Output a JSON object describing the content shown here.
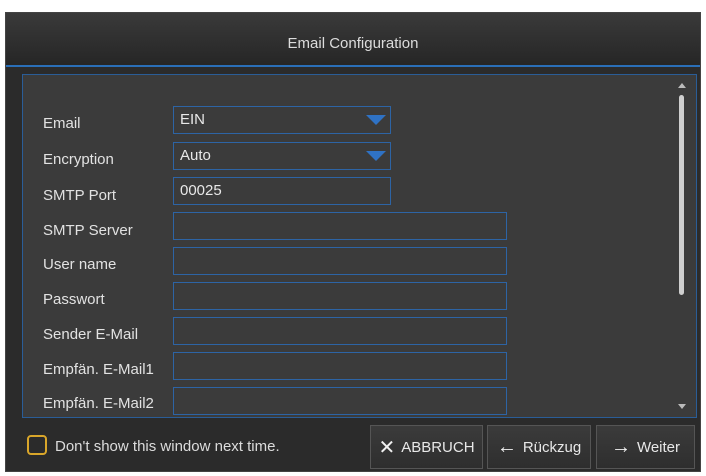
{
  "window": {
    "title": "Email Configuration"
  },
  "form": {
    "rows": [
      {
        "label": "Email",
        "value": "EIN",
        "type": "select"
      },
      {
        "label": "Encryption",
        "value": "Auto",
        "type": "select"
      },
      {
        "label": "SMTP Port",
        "value": "00025",
        "type": "text"
      },
      {
        "label": "SMTP Server",
        "value": "",
        "type": "text"
      },
      {
        "label": "User name",
        "value": "",
        "type": "text"
      },
      {
        "label": "Passwort",
        "value": "",
        "type": "password"
      },
      {
        "label": "Sender E-Mail",
        "value": "",
        "type": "text"
      },
      {
        "label": "Empfän. E-Mail1",
        "value": "",
        "type": "text"
      },
      {
        "label": "Empfän. E-Mail2",
        "value": "",
        "type": "text"
      }
    ]
  },
  "footer": {
    "checkbox_label": "Don't show this window next time.",
    "cancel_label": "ABBRUCH",
    "back_label": "Rückzug",
    "next_label": "Weiter"
  },
  "icons": {
    "cancel": "close-icon",
    "back": "arrow-left-icon",
    "next": "arrow-right-icon",
    "dropdown": "chevron-down-icon"
  },
  "colors": {
    "accent": "#2f72c4",
    "checkbox": "#d9a62a",
    "panel": "#3b3b3b"
  }
}
